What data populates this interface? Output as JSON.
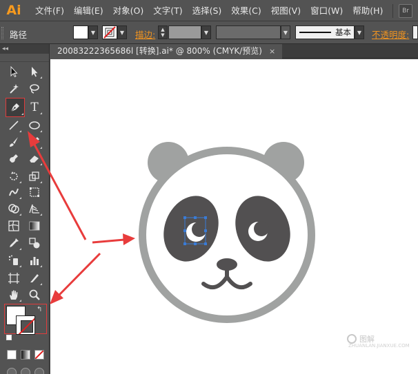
{
  "app": {
    "logo": "Ai",
    "bridge_label": "Br"
  },
  "menu": [
    "文件(F)",
    "编辑(E)",
    "对象(O)",
    "文字(T)",
    "选择(S)",
    "效果(C)",
    "视图(V)",
    "窗口(W)",
    "帮助(H)"
  ],
  "control_bar": {
    "object_type": "路径",
    "stroke_label": "描边:",
    "stroke_style": "基本",
    "opacity_label": "不透明度:"
  },
  "tool_panel": {
    "collapse_label": "◂◂"
  },
  "document": {
    "tab_title": "20083222365686l  [转换].ai* @ 800% (CMYK/预览)",
    "close_label": "×"
  },
  "watermark": {
    "text": "图解",
    "sub": "ZHUANLAN.JIANXUE.COM"
  },
  "colors": {
    "ui_bg": "#535353",
    "accent_orange": "#f2941f",
    "highlight_red": "#e03c3c",
    "panda_gray": "#a0a2a1",
    "panda_dark": "#525051",
    "selection_blue": "#3a7bd5"
  },
  "icons": [
    "selection-icon",
    "direct-selection-icon",
    "magic-wand-icon",
    "lasso-icon",
    "pen-icon",
    "type-icon",
    "line-icon",
    "ellipse-icon",
    "paintbrush-icon",
    "pencil-icon",
    "blob-brush-icon",
    "eraser-icon",
    "rotate-icon",
    "scale-icon",
    "warp-icon",
    "free-transform-icon",
    "shape-builder-icon",
    "perspective-icon",
    "mesh-icon",
    "gradient-icon",
    "eyedropper-icon",
    "blend-icon",
    "symbol-sprayer-icon",
    "column-graph-icon",
    "artboard-icon",
    "slice-icon",
    "hand-icon",
    "zoom-icon"
  ]
}
